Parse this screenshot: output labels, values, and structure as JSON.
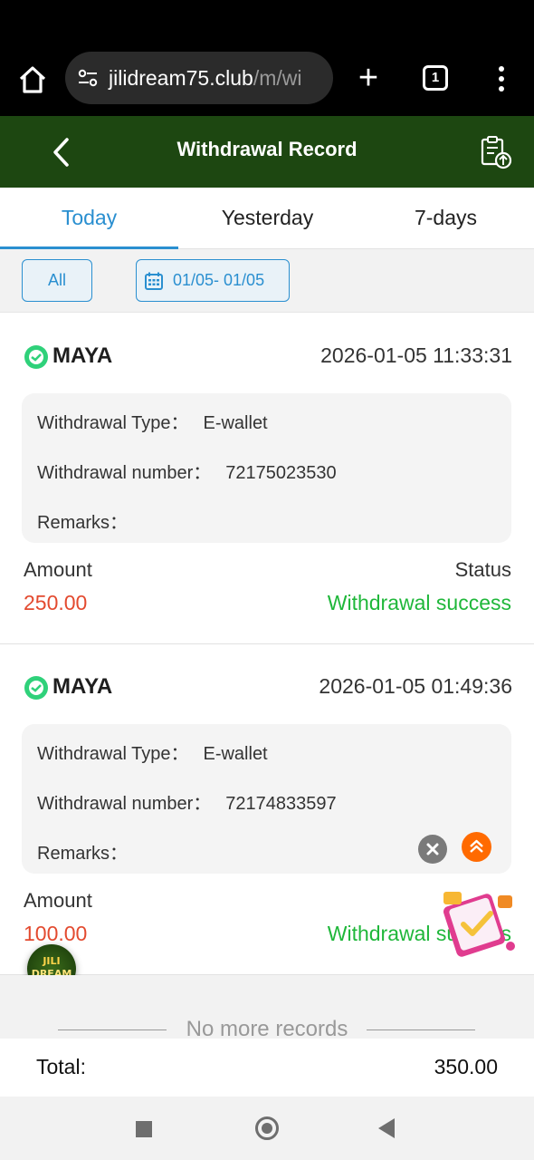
{
  "browser": {
    "url_host": "jilidream75.club",
    "url_path": "/m/wi",
    "tab_count": "1"
  },
  "header": {
    "title": "Withdrawal Record"
  },
  "tabs": [
    {
      "label": "Today",
      "active": true
    },
    {
      "label": "Yesterday",
      "active": false
    },
    {
      "label": "7-days",
      "active": false
    }
  ],
  "filters": {
    "all_label": "All",
    "date_range": "01/05- 01/05"
  },
  "records": [
    {
      "method": "MAYA",
      "datetime": "2026-01-05 11:33:31",
      "type_label": "Withdrawal Type：",
      "type_value": "E-wallet",
      "number_label": "Withdrawal number：",
      "number_value": "72175023530",
      "remarks_label": "Remarks：",
      "amount_label": "Amount",
      "amount_value": "250.00",
      "status_label": "Status",
      "status_value": "Withdrawal success"
    },
    {
      "method": "MAYA",
      "datetime": "2026-01-05 01:49:36",
      "type_label": "Withdrawal Type：",
      "type_value": "E-wallet",
      "number_label": "Withdrawal number：",
      "number_value": "72174833597",
      "remarks_label": "Remarks：",
      "amount_label": "Amount",
      "amount_value": "100.00",
      "status_value": "Withdrawal success"
    }
  ],
  "footer": {
    "no_more": "No more records",
    "total_label": "Total:",
    "total_value": "350.00"
  },
  "floating": {
    "logo_line1": "JILI",
    "logo_line2": "DREAM"
  },
  "colors": {
    "header_bg": "#1d4711",
    "accent": "#2a8fd0",
    "amount": "#e34a2f",
    "success": "#1fb73a"
  }
}
